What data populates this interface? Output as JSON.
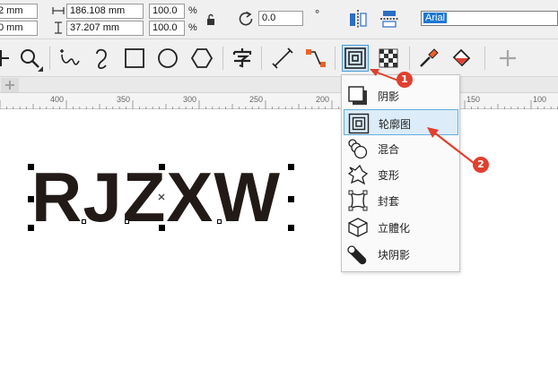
{
  "property_bar": {
    "x_value": "2 mm",
    "y_value": "0 mm",
    "width_value": "186.108 mm",
    "height_value": "37.207 mm",
    "scale_x": "100.0",
    "scale_y": "100.0",
    "percent_x": "%",
    "percent_y": "%",
    "rotation_value": "0.0",
    "rotation_unit": "°",
    "font_name": "Arial"
  },
  "ruler": {
    "labels": [
      "400",
      "350",
      "300",
      "250",
      "200",
      "150",
      "100"
    ]
  },
  "canvas": {
    "artistic_text": "RJZXW"
  },
  "effects_menu": {
    "items": [
      {
        "label": "阴影",
        "icon": "drop-shadow-icon"
      },
      {
        "label": "轮廓图",
        "icon": "contour-icon",
        "highlighted": true
      },
      {
        "label": "混合",
        "icon": "blend-icon"
      },
      {
        "label": "变形",
        "icon": "distort-icon"
      },
      {
        "label": "封套",
        "icon": "envelope-icon"
      },
      {
        "label": "立體化",
        "icon": "extrude-icon"
      },
      {
        "label": "块阴影",
        "icon": "block-shadow-icon"
      }
    ]
  },
  "annotations": {
    "badge_1": "1",
    "badge_2": "2",
    "color": "#e0402f"
  },
  "colors": {
    "highlight_bg": "#dcecf8",
    "highlight_border": "#64aedc",
    "font_field_bg": "#1e78d2",
    "text_fill": "#211a17"
  }
}
